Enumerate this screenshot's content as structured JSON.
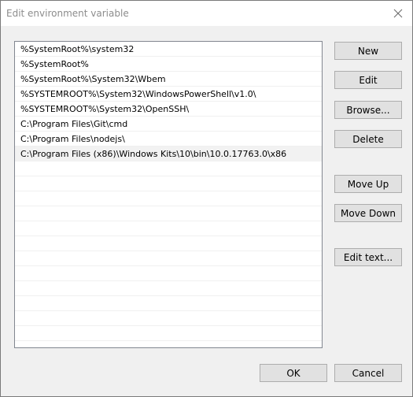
{
  "window": {
    "title": "Edit environment variable"
  },
  "paths": [
    "%SystemRoot%\\system32",
    "%SystemRoot%",
    "%SystemRoot%\\System32\\Wbem",
    "%SYSTEMROOT%\\System32\\WindowsPowerShell\\v1.0\\",
    "%SYSTEMROOT%\\System32\\OpenSSH\\",
    "C:\\Program Files\\Git\\cmd",
    "C:\\Program Files\\nodejs\\",
    "C:\\Program Files (x86)\\Windows Kits\\10\\bin\\10.0.17763.0\\x86"
  ],
  "selected_index": 7,
  "buttons": {
    "new": "New",
    "edit": "Edit",
    "browse": "Browse...",
    "delete": "Delete",
    "move_up": "Move Up",
    "move_down": "Move Down",
    "edit_text": "Edit text...",
    "ok": "OK",
    "cancel": "Cancel"
  },
  "icons": {
    "close": "close-icon"
  }
}
